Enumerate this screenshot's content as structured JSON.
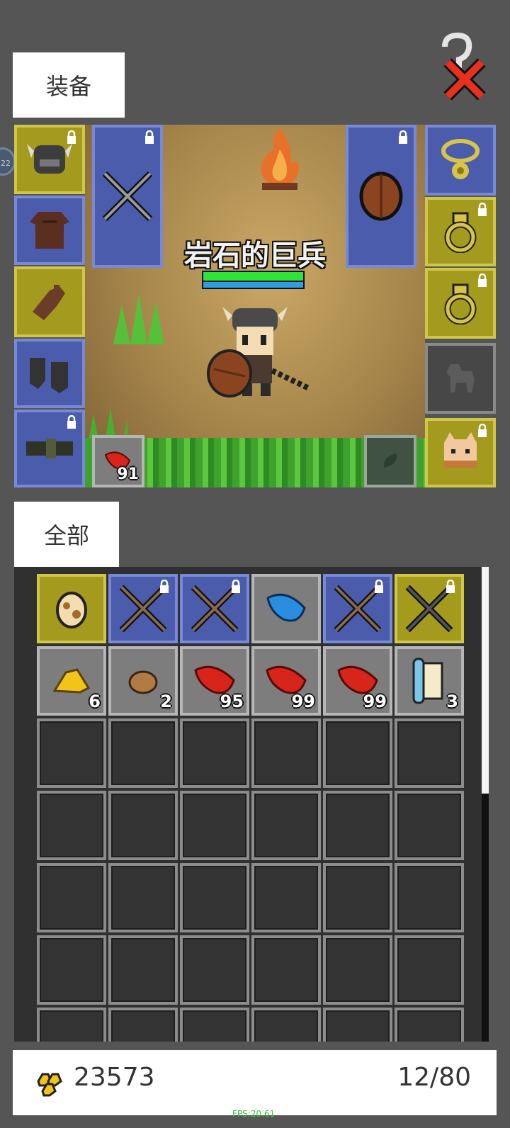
{
  "tabs": {
    "equipment": "装备",
    "all": "全部"
  },
  "side_bubble": "22",
  "scene": {
    "boss_name": "岩石的巨兵",
    "consumable_count": "91"
  },
  "equipment_left": [
    {
      "name": "helmet",
      "color": "yellow",
      "locked": true
    },
    {
      "name": "armor",
      "color": "blue",
      "locked": false
    },
    {
      "name": "gloves",
      "color": "yellow",
      "locked": false
    },
    {
      "name": "boots",
      "color": "blue",
      "locked": false
    },
    {
      "name": "belt",
      "color": "blue",
      "locked": true
    }
  ],
  "equipment_right": [
    {
      "name": "necklace",
      "color": "blue",
      "locked": false
    },
    {
      "name": "ring-1",
      "color": "yellow",
      "locked": true
    },
    {
      "name": "ring-2",
      "color": "yellow",
      "locked": true
    },
    {
      "name": "mount-empty",
      "color": "dark",
      "locked": false
    },
    {
      "name": "pet",
      "color": "yellow",
      "locked": true
    }
  ],
  "inventory_row1": [
    {
      "item": "egg-icon",
      "color": "yellow",
      "locked": false
    },
    {
      "item": "crossed-spears-icon",
      "color": "blue",
      "locked": true
    },
    {
      "item": "crossed-spears-icon",
      "color": "blue",
      "locked": true
    },
    {
      "item": "blue-leaf-icon",
      "color": "gray",
      "locked": false
    },
    {
      "item": "crossed-spears-icon",
      "color": "blue",
      "locked": true
    },
    {
      "item": "crossed-spears-icon",
      "color": "yellow",
      "locked": true
    }
  ],
  "inventory_row2": [
    {
      "item": "gold-ore-icon",
      "count": "6"
    },
    {
      "item": "copper-ore-icon",
      "count": "2"
    },
    {
      "item": "red-leaf-icon",
      "count": "95"
    },
    {
      "item": "red-leaf-icon",
      "count": "99"
    },
    {
      "item": "red-leaf-icon",
      "count": "99"
    },
    {
      "item": "scroll-icon",
      "count": "3"
    }
  ],
  "footer": {
    "gold": "23573",
    "capacity": "12/80"
  },
  "fps": "FPS:20.61",
  "colors": {
    "yellow_slot": "#a49a1d",
    "blue_slot": "#4b5cad",
    "gray_slot": "#7d7d7d",
    "background": "#555555"
  }
}
